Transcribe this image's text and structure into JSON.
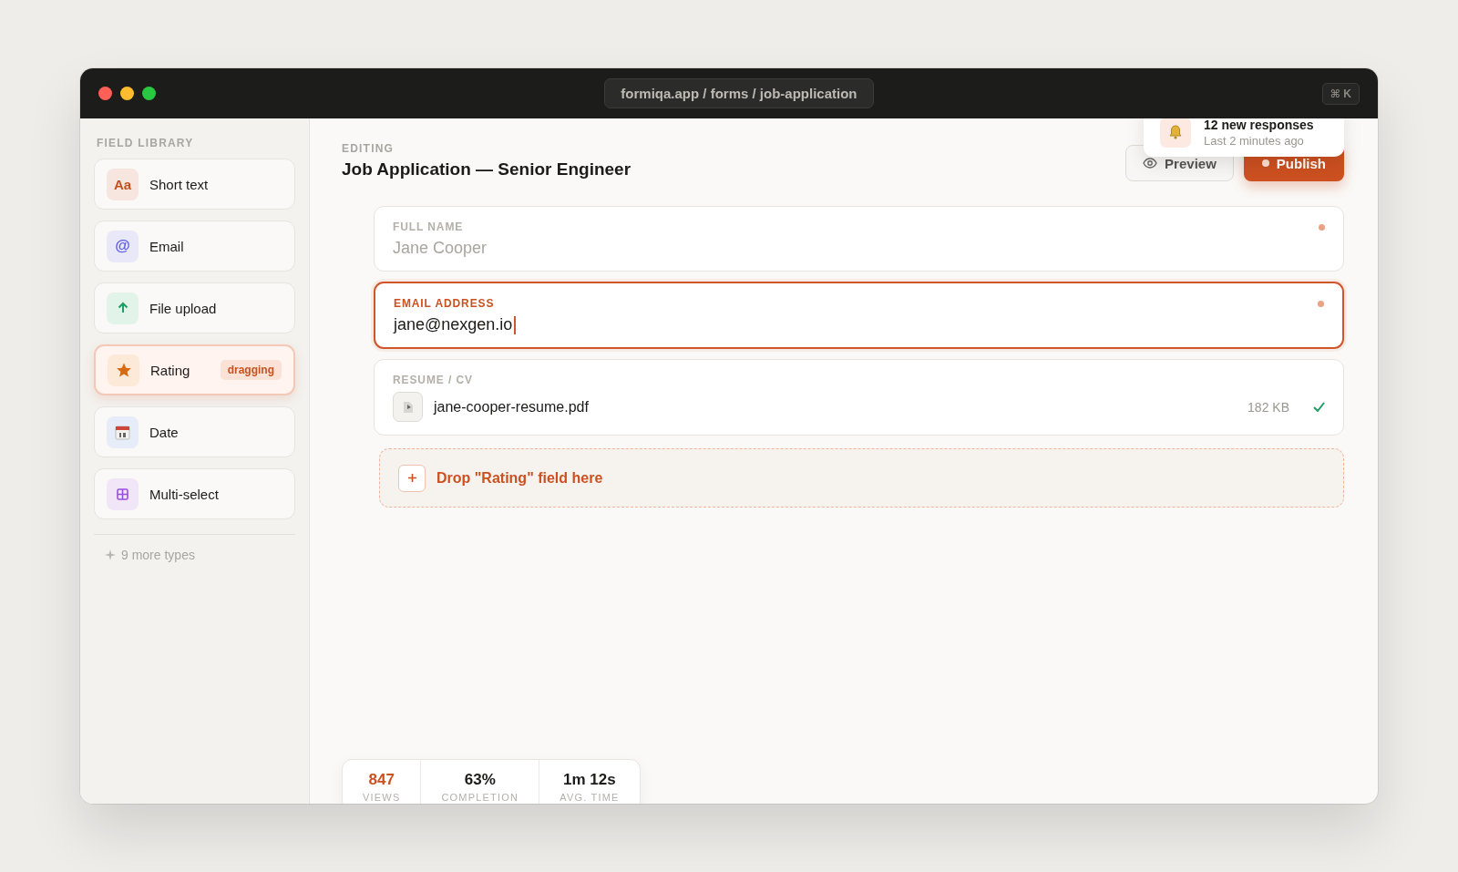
{
  "window": {
    "url": "formiqa.app / forms / job-application",
    "shortcut": "⌘ K"
  },
  "sidebar": {
    "heading": "FIELD LIBRARY",
    "items": [
      {
        "kind": "text",
        "glyph": "Aa",
        "label": "Short text",
        "color": "#f7e6df",
        "dragging": false
      },
      {
        "kind": "email",
        "glyph": "@",
        "label": "Email",
        "color": "#e8e8f8",
        "dragging": false
      },
      {
        "kind": "upload",
        "label": "File upload",
        "color": "#e2f3ea",
        "dragging": false
      },
      {
        "kind": "rating",
        "label": "Rating",
        "color": "#fde9d8",
        "dragging": true,
        "badge": "dragging"
      },
      {
        "kind": "date",
        "label": "Date",
        "color": "#e6ecf8",
        "dragging": false
      },
      {
        "kind": "multi",
        "label": "Multi-select",
        "color": "#f0e6f8",
        "dragging": false
      }
    ],
    "more": "9 more types"
  },
  "header": {
    "eyebrow": "EDITING",
    "title": "Job Application — Senior Engineer",
    "preview": "Preview",
    "publish": "Publish"
  },
  "toast": {
    "title": "12 new responses",
    "subtitle": "Last 2 minutes ago"
  },
  "fields": [
    {
      "kind": "text",
      "label": "FULL NAME",
      "placeholder": "Jane Cooper",
      "required": true,
      "focused": false
    },
    {
      "kind": "text",
      "label": "EMAIL ADDRESS",
      "value": "jane@nexgen.io",
      "required": true,
      "focused": true
    },
    {
      "kind": "file",
      "label": "RESUME / CV",
      "filename": "jane-cooper-resume.pdf",
      "size": "182 KB",
      "uploaded": true,
      "focused": false
    }
  ],
  "dropzone": {
    "text": "Drop \"Rating\" field here"
  },
  "stats": [
    {
      "value": "847",
      "label": "VIEWS",
      "accent": true
    },
    {
      "value": "63%",
      "label": "COMPLETION",
      "accent": false
    },
    {
      "value": "1m 12s",
      "label": "AVG. TIME",
      "accent": false
    }
  ]
}
